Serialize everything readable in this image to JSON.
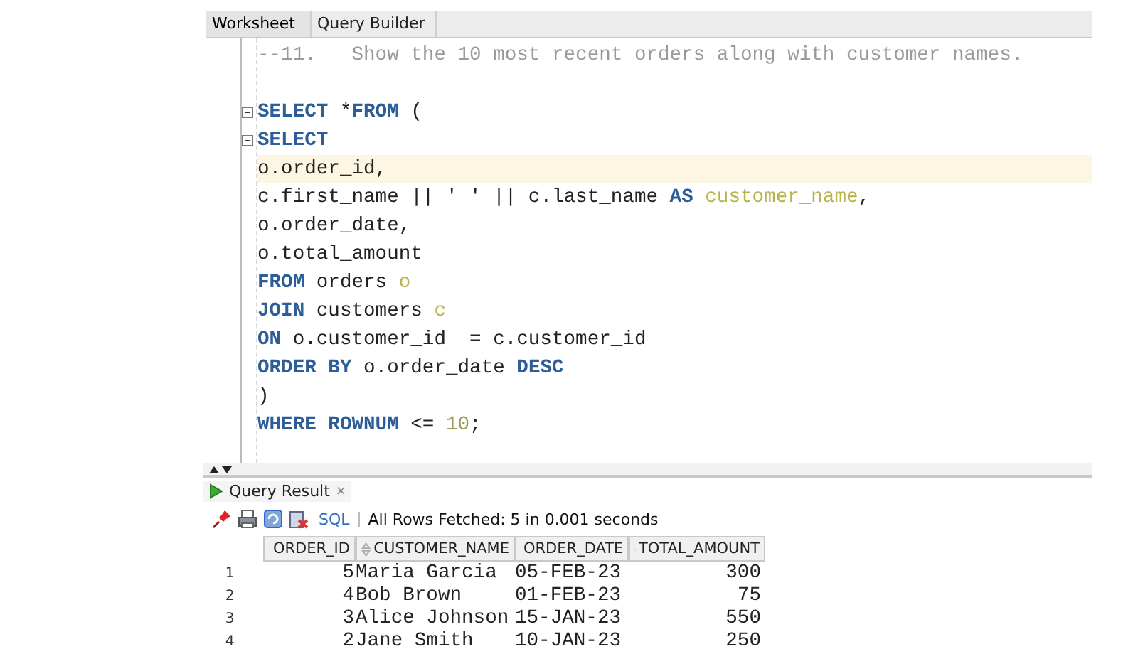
{
  "tabs": [
    {
      "label": "Worksheet",
      "selected": true
    },
    {
      "label": "Query Builder",
      "selected": false
    }
  ],
  "editor": {
    "blocks": [
      {
        "lines": [
          {
            "highlighted": false,
            "tokens": [
              {
                "kind": "comment",
                "text": "--11.   Show the 10 most recent orders along with customer names."
              }
            ]
          }
        ]
      },
      {
        "lines": [
          {
            "fold": true,
            "highlighted": false,
            "tokens": [
              {
                "kind": "keyword",
                "text": "SELECT"
              },
              {
                "kind": "plain",
                "text": " *"
              },
              {
                "kind": "keyword",
                "text": "FROM"
              },
              {
                "kind": "plain",
                "text": " ("
              }
            ]
          },
          {
            "fold": true,
            "highlighted": false,
            "tokens": [
              {
                "kind": "keyword",
                "text": "SELECT"
              }
            ]
          },
          {
            "highlighted": true,
            "tokens": [
              {
                "kind": "plain",
                "text": "o.order_id,"
              }
            ]
          },
          {
            "highlighted": false,
            "tokens": [
              {
                "kind": "plain",
                "text": "c.first_name || ' ' || c.last_name "
              },
              {
                "kind": "keyword",
                "text": "AS"
              },
              {
                "kind": "alias",
                "text": " customer_name"
              },
              {
                "kind": "plain",
                "text": ","
              }
            ]
          },
          {
            "highlighted": false,
            "tokens": [
              {
                "kind": "plain",
                "text": "o.order_date,"
              }
            ]
          },
          {
            "highlighted": false,
            "tokens": [
              {
                "kind": "plain",
                "text": "o.total_amount"
              }
            ]
          },
          {
            "highlighted": false,
            "tokens": [
              {
                "kind": "keyword",
                "text": "FROM"
              },
              {
                "kind": "plain",
                "text": " orders "
              },
              {
                "kind": "alias",
                "text": "o"
              }
            ]
          },
          {
            "highlighted": false,
            "tokens": [
              {
                "kind": "keyword",
                "text": "JOIN"
              },
              {
                "kind": "plain",
                "text": " customers "
              },
              {
                "kind": "alias",
                "text": "c"
              }
            ]
          },
          {
            "highlighted": false,
            "tokens": [
              {
                "kind": "keyword",
                "text": "ON"
              },
              {
                "kind": "plain",
                "text": " o.customer_id  = c.customer_id"
              }
            ]
          },
          {
            "highlighted": false,
            "tokens": [
              {
                "kind": "keyword",
                "text": "ORDER BY"
              },
              {
                "kind": "plain",
                "text": " o.order_date "
              },
              {
                "kind": "keyword",
                "text": "DESC"
              }
            ]
          },
          {
            "highlighted": false,
            "tokens": [
              {
                "kind": "plain",
                "text": ")"
              }
            ]
          },
          {
            "highlighted": false,
            "tokens": [
              {
                "kind": "keyword",
                "text": "WHERE ROWNUM"
              },
              {
                "kind": "plain",
                "text": " <= "
              },
              {
                "kind": "number",
                "text": "10"
              },
              {
                "kind": "plain",
                "text": ";"
              }
            ]
          }
        ]
      }
    ]
  },
  "results": {
    "tab": {
      "label": "Query Result",
      "close": "×"
    },
    "toolbar": {
      "sql": "SQL",
      "status": "All Rows Fetched: 5 in 0.001 seconds"
    },
    "table": {
      "columns": [
        "ORDER_ID",
        "CUSTOMER_NAME",
        "ORDER_DATE",
        "TOTAL_AMOUNT"
      ],
      "rows": [
        {
          "number": "1",
          "cells": [
            "5",
            "Maria Garcia",
            "05-FEB-23",
            "300"
          ]
        },
        {
          "number": "2",
          "cells": [
            "4",
            "Bob Brown",
            "01-FEB-23",
            "75"
          ]
        },
        {
          "number": "3",
          "cells": [
            "3",
            "Alice Johnson",
            "15-JAN-23",
            "550"
          ]
        },
        {
          "number": "4",
          "cells": [
            "2",
            "Jane Smith",
            "10-JAN-23",
            "250"
          ]
        }
      ]
    }
  }
}
